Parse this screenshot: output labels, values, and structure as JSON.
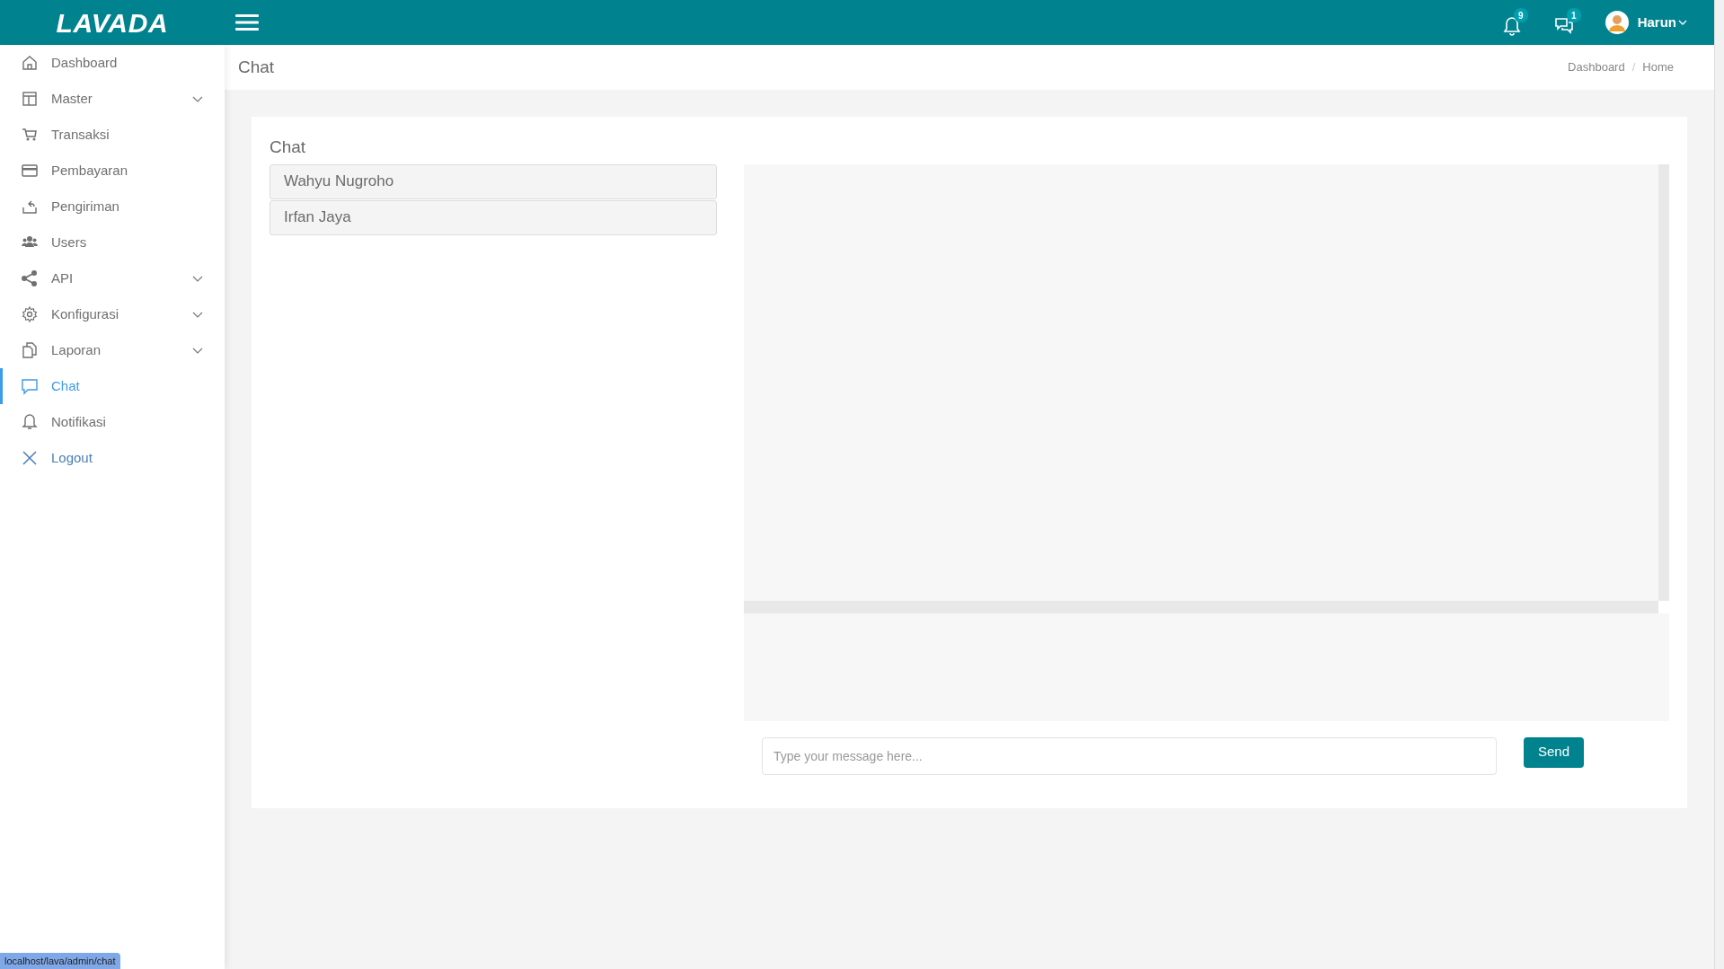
{
  "topbar": {
    "logo": "LAVADA",
    "notifications": {
      "count": "9"
    },
    "messages": {
      "count": "1"
    },
    "user": {
      "name": "Harun"
    }
  },
  "sidebar": {
    "items": [
      {
        "label": "Dashboard",
        "expandable": false,
        "selected": false
      },
      {
        "label": "Master",
        "expandable": true,
        "selected": false
      },
      {
        "label": "Transaksi",
        "expandable": false,
        "selected": false
      },
      {
        "label": "Pembayaran",
        "expandable": false,
        "selected": false
      },
      {
        "label": "Pengiriman",
        "expandable": false,
        "selected": false
      },
      {
        "label": "Users",
        "expandable": false,
        "selected": false
      },
      {
        "label": "API",
        "expandable": true,
        "selected": false
      },
      {
        "label": "Konfigurasi",
        "expandable": true,
        "selected": false
      },
      {
        "label": "Laporan",
        "expandable": true,
        "selected": false
      },
      {
        "label": "Chat",
        "expandable": false,
        "selected": true
      },
      {
        "label": "Notifikasi",
        "expandable": false,
        "selected": false
      },
      {
        "label": "Logout",
        "expandable": false,
        "selected": false
      }
    ]
  },
  "page_header": {
    "title": "Chat",
    "breadcrumb": [
      "Dashboard",
      "Home"
    ],
    "breadcrumb_separator": "/"
  },
  "card": {
    "title": "Chat",
    "contacts": [
      {
        "name": "Wahyu Nugroho"
      },
      {
        "name": "Irfan Jaya"
      }
    ],
    "message_input": {
      "placeholder": "Type your message here..."
    },
    "send_button": "Send"
  },
  "status_bar": {
    "url": "localhost/lava/admin/chat"
  }
}
